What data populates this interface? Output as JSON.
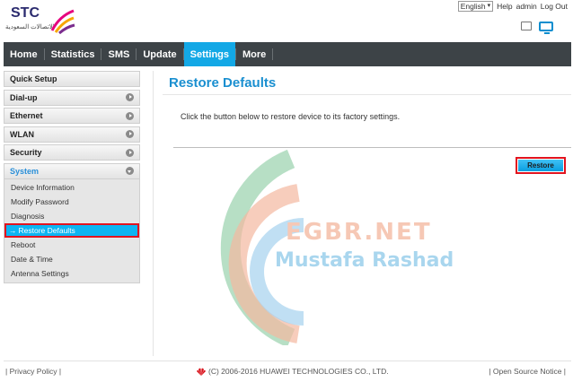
{
  "header": {
    "logo_text": "STC",
    "logo_arabic": "الاتصالات السعودية",
    "language": "English",
    "help": "Help",
    "user": "admin",
    "logout": "Log Out"
  },
  "nav": {
    "items": [
      {
        "label": "Home"
      },
      {
        "label": "Statistics"
      },
      {
        "label": "SMS"
      },
      {
        "label": "Update"
      },
      {
        "label": "Settings",
        "active": true
      },
      {
        "label": "More"
      }
    ]
  },
  "sidebar": {
    "items": [
      {
        "label": "Quick Setup"
      },
      {
        "label": "Dial-up"
      },
      {
        "label": "Ethernet"
      },
      {
        "label": "WLAN"
      },
      {
        "label": "Security"
      },
      {
        "label": "System",
        "open": true
      }
    ],
    "system_submenu": [
      {
        "label": "Device Information"
      },
      {
        "label": "Modify Password"
      },
      {
        "label": "Diagnosis"
      },
      {
        "label": "Restore Defaults",
        "active": true
      },
      {
        "label": "Reboot"
      },
      {
        "label": "Date & Time"
      },
      {
        "label": "Antenna Settings"
      }
    ],
    "active_arrow": "→"
  },
  "main": {
    "title": "Restore Defaults",
    "description": "Click the button below to restore device to its factory settings.",
    "restore_button": "Restore"
  },
  "watermark": {
    "line1": "EGBR.NET",
    "line2": "Mustafa Rashad"
  },
  "footer": {
    "privacy": "| Privacy Policy |",
    "copyright": "(C) 2006-2016 HUAWEI TECHNOLOGIES CO., LTD.",
    "open_source": "| Open Source Notice |"
  },
  "colors": {
    "accent": "#13a8e6",
    "nav_bg": "#3d4347",
    "title_blue": "#1a8fd0",
    "highlight_red": "#e2141f"
  },
  "icons": [
    "stc-logo-icon",
    "language-dropdown-icon",
    "sim-status-icon",
    "pc-connection-icon",
    "chevron-right-icon",
    "chevron-down-icon",
    "huawei-logo-icon"
  ]
}
